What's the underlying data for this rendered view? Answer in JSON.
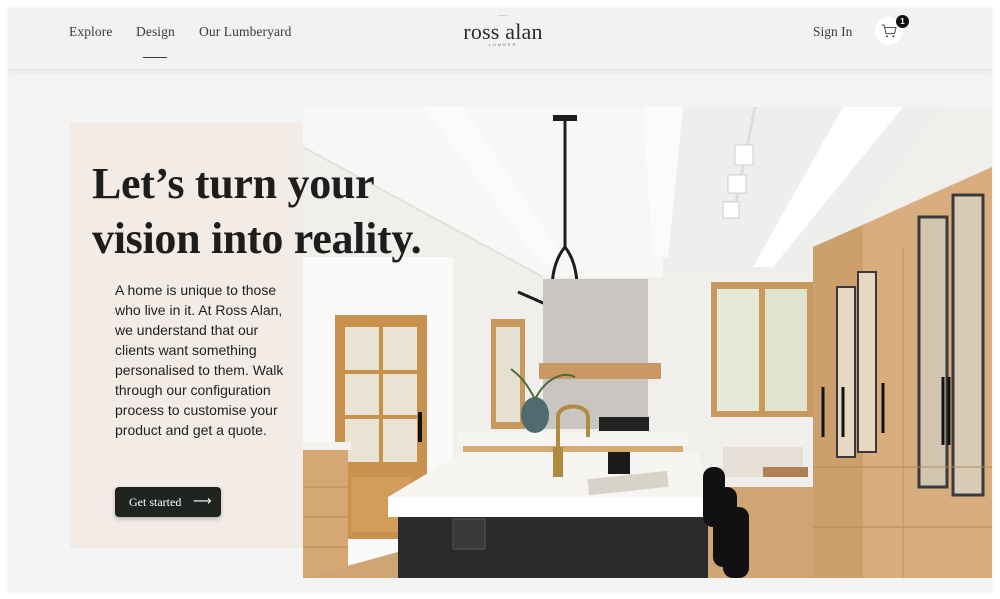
{
  "nav": {
    "items": [
      {
        "label": "Explore"
      },
      {
        "label": "Design"
      },
      {
        "label": "Our Lumberyard"
      }
    ]
  },
  "logo": {
    "text": "ross alan",
    "subtext": "LUMBER"
  },
  "header": {
    "sign_in_label": "Sign In",
    "cart_count": "1",
    "cart_icon": "cart-icon"
  },
  "hero": {
    "title_line1": "Let’s turn your",
    "title_line2": "vision into reality.",
    "body": "A home is unique to those who live in it. At Ross Alan, we understand that our clients want something personalised to them. Walk through our configuration process to customise your product and get a quote.",
    "cta_label": "Get started",
    "cta_icon": "arrow-right-icon"
  },
  "colors": {
    "panel": "#f3ebe6",
    "button": "#1f2421",
    "background": "#f4f4f4"
  }
}
